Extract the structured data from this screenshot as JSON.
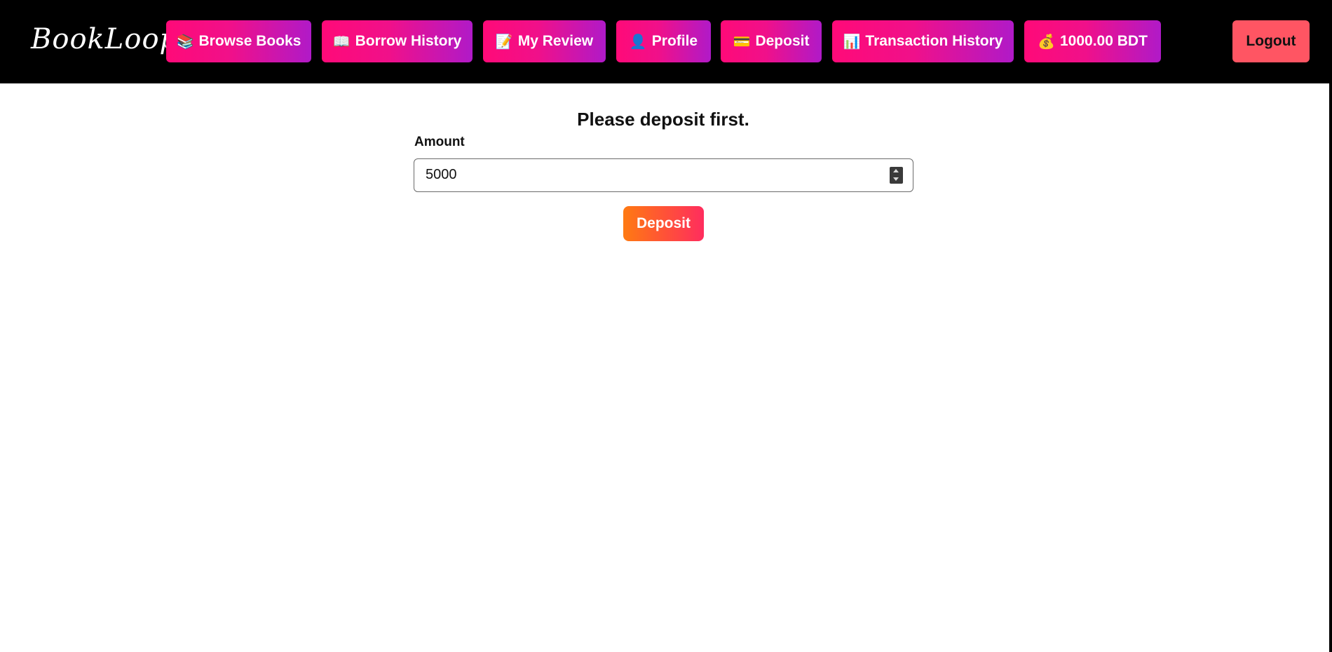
{
  "navbar": {
    "brand": "BookLoop",
    "items": [
      {
        "icon": "📚",
        "icon_name": "books-icon",
        "label": "Browse Books"
      },
      {
        "icon": "📖",
        "icon_name": "open-book-icon",
        "label": "Borrow History"
      },
      {
        "icon": "📝",
        "icon_name": "memo-icon",
        "label": "My Review"
      },
      {
        "icon": "👤",
        "icon_name": "user-icon",
        "label": "Profile"
      },
      {
        "icon": "💳",
        "icon_name": "credit-card-icon",
        "label": "Deposit"
      },
      {
        "icon": "📊",
        "icon_name": "bar-chart-icon",
        "label": "Transaction History"
      },
      {
        "icon": "💰",
        "icon_name": "money-bag-icon",
        "label": "1000.00 BDT"
      }
    ],
    "logout_label": "Logout"
  },
  "main": {
    "heading": "Please deposit first.",
    "amount_label": "Amount",
    "amount_value": "5000",
    "deposit_button_label": "Deposit"
  },
  "colors": {
    "navbar_bg": "#000000",
    "nav_button_gradient_start": "#ff0a78",
    "nav_button_gradient_end": "#b01ac8",
    "logout_bg": "#ff5563",
    "deposit_gradient_start": "#ff7a12",
    "deposit_gradient_end": "#ff2d5e"
  }
}
